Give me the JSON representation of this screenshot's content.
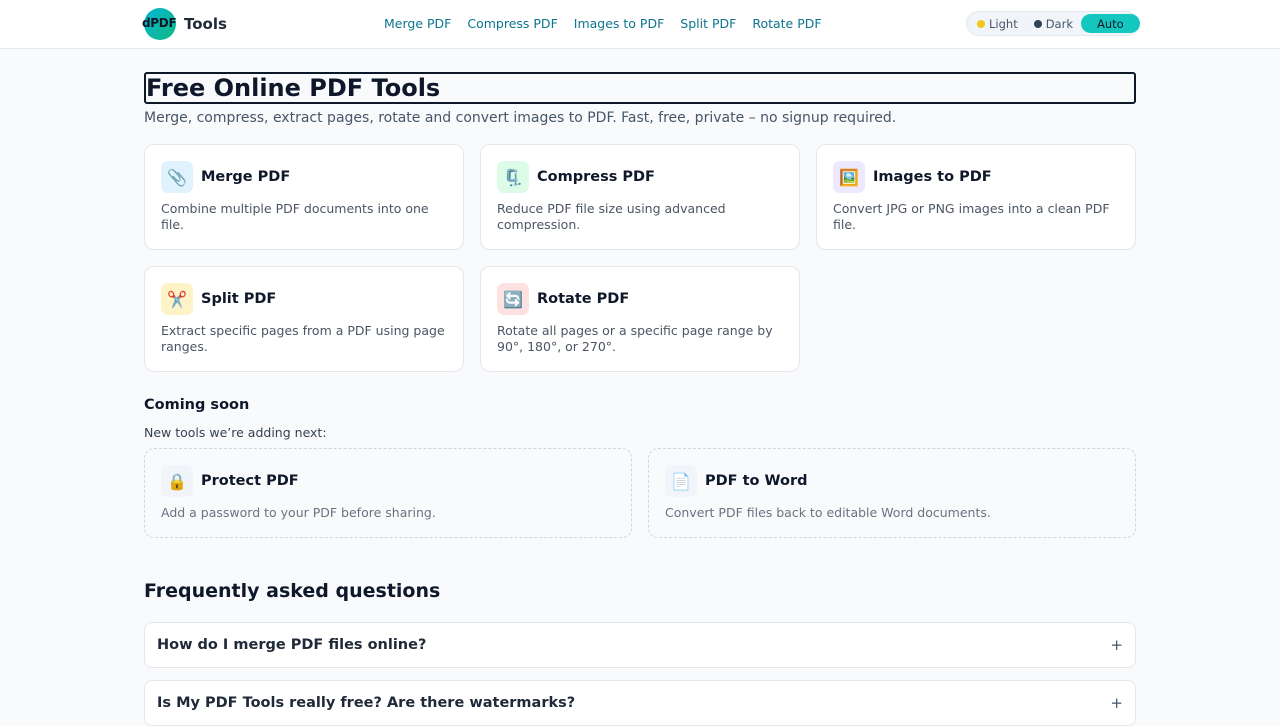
{
  "header": {
    "logo_text": "dPDF",
    "brand": "Tools",
    "nav": [
      "Merge PDF",
      "Compress PDF",
      "Images to PDF",
      "Split PDF",
      "Rotate PDF"
    ],
    "theme": {
      "light": "Light",
      "dark": "Dark",
      "auto": "Auto",
      "selected": "Auto",
      "light_dot_color": "#f5c518",
      "dark_dot_color": "#334155",
      "active_color": "#14c8c0"
    }
  },
  "main": {
    "title": "Free Online PDF Tools",
    "subtitle": "Merge, compress, extract pages, rotate and convert images to PDF. Fast, free, private – no signup required.",
    "tools": [
      {
        "icon": "paperclip-icon",
        "glyph": "📎",
        "title": "Merge PDF",
        "desc": "Combine multiple PDF documents into one file.",
        "icon_bg": "#e0f2fe"
      },
      {
        "icon": "clamp-icon",
        "glyph": "🗜️",
        "title": "Compress PDF",
        "desc": "Reduce PDF file size using advanced compression.",
        "icon_bg": "#dcfce7"
      },
      {
        "icon": "framed-picture-icon",
        "glyph": "🖼️",
        "title": "Images to PDF",
        "desc": "Convert JPG or PNG images into a clean PDF file.",
        "icon_bg": "#ede9fe"
      },
      {
        "icon": "scissors-icon",
        "glyph": "✂️",
        "title": "Split PDF",
        "desc": "Extract specific pages from a PDF using page ranges.",
        "icon_bg": "#fef3c7"
      },
      {
        "icon": "rotate-icon",
        "glyph": "🔄",
        "title": "Rotate PDF",
        "desc": "Rotate all pages or a specific page range by 90°, 180°, or 270°.",
        "icon_bg": "#fee2e2"
      }
    ],
    "coming_soon": {
      "title": "Coming soon",
      "subtitle": "New tools we’re adding next:",
      "items": [
        {
          "icon": "lock-icon",
          "glyph": "🔒",
          "title": "Protect PDF",
          "desc": "Add a password to your PDF before sharing."
        },
        {
          "icon": "document-icon",
          "glyph": "📄",
          "title": "PDF to Word",
          "desc": "Convert PDF files back to editable Word documents."
        }
      ]
    },
    "faq": {
      "title": "Frequently asked questions",
      "items": [
        {
          "q": "How do I merge PDF files online?",
          "toggle": "+"
        },
        {
          "q": "Is My PDF Tools really free? Are there watermarks?",
          "toggle": "+"
        }
      ]
    }
  }
}
